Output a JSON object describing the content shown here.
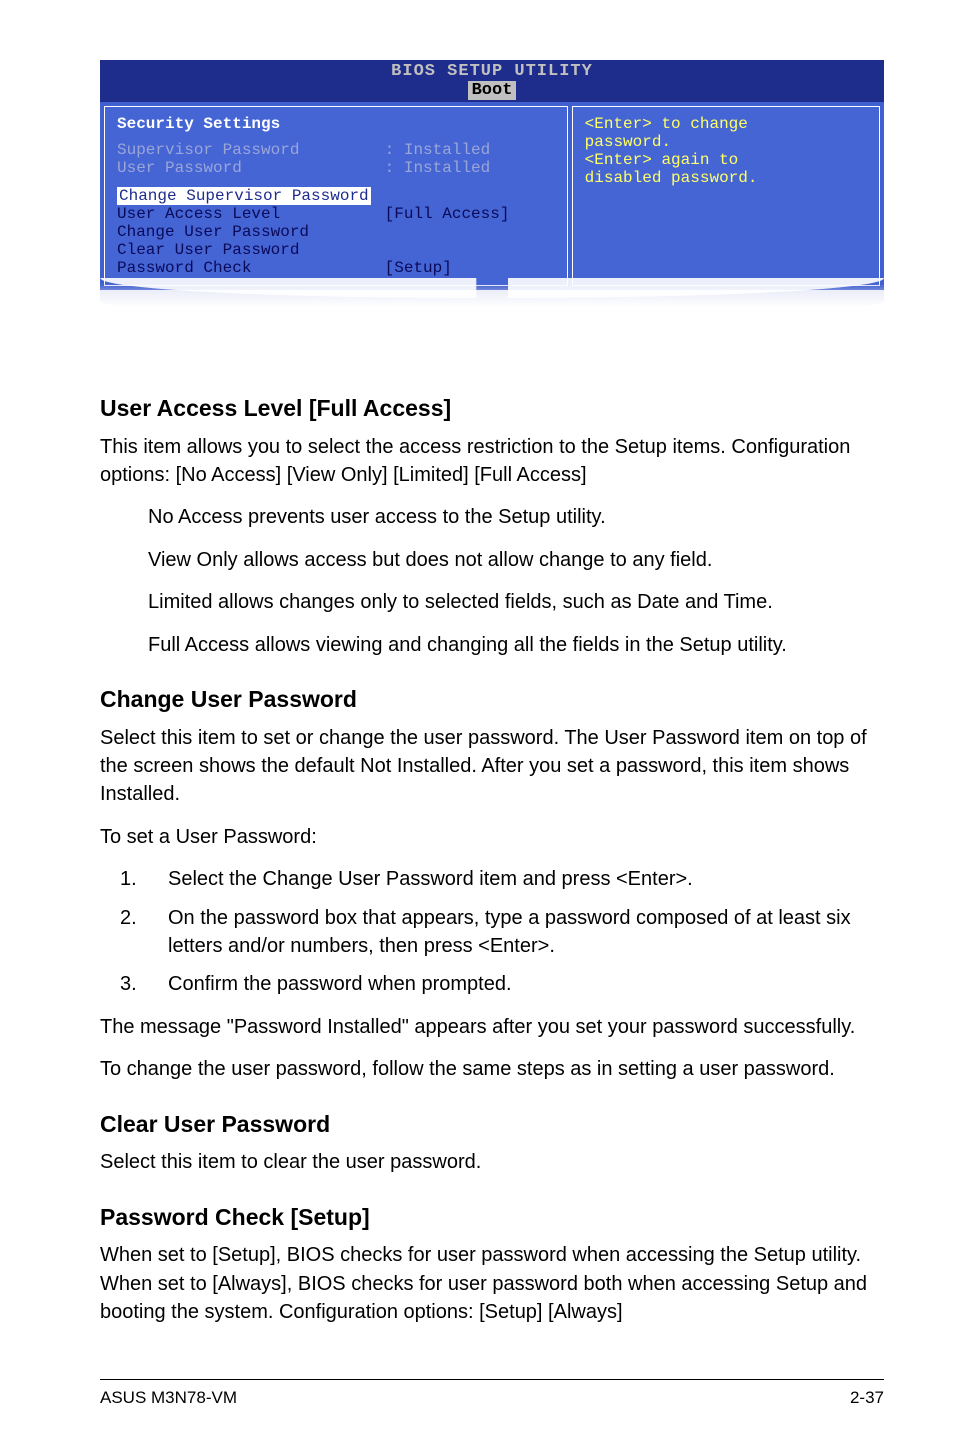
{
  "bios": {
    "title1": "BIOS SETUP UTILITY",
    "title2": "Boot",
    "left": {
      "heading": "Security Settings",
      "rows_grey": [
        {
          "label": "Supervisor Password",
          "value": ": Installed"
        },
        {
          "label": "User Password",
          "value": ": Installed"
        }
      ],
      "row_hl": "Change Supervisor Password",
      "rows_blue": [
        {
          "label": "User Access Level",
          "value": "[Full Access]"
        },
        {
          "label": "Change User Password",
          "value": ""
        },
        {
          "label": "Clear User Password",
          "value": ""
        },
        {
          "label": "Password Check",
          "value": "[Setup]"
        }
      ]
    },
    "right": {
      "l1": "<Enter> to change",
      "l2": "password.",
      "l3": "<Enter> again to",
      "l4": "disabled password."
    }
  },
  "doc": {
    "h_ual": "User Access Level [Full Access]",
    "ual_p": "This item allows you to select the access restriction to the Setup items. Configuration options: [No Access] [View Only] [Limited] [Full Access]",
    "ual_i1": "No Access prevents user access to the Setup utility.",
    "ual_i2": "View Only allows access but does not allow change to any field.",
    "ual_i3": "Limited allows changes only to selected fields, such as Date and Time.",
    "ual_i4": "Full Access allows viewing and changing all the fields in the Setup utility.",
    "h_cup": "Change User Password",
    "cup_p1": "Select this item to set or change the user password. The User Password item on top of the screen shows the default Not Installed. After you set a password, this item shows Installed.",
    "cup_p2": "To set a User Password:",
    "ol1": "Select the Change User Password item and press <Enter>.",
    "ol2": "On the password box that appears, type a password composed of at least six letters and/or numbers, then press <Enter>.",
    "ol3": "Confirm the password when prompted.",
    "cup_p3": "The message \"Password Installed\" appears after you set your password successfully.",
    "cup_p4": "To change the user password, follow the same steps as in setting a user password.",
    "h_clr": "Clear User Password",
    "clr_p": "Select this item to clear the user password.",
    "h_pwc": "Password Check [Setup]",
    "pwc_p": "When set to [Setup], BIOS checks for user password when accessing the Setup utility. When set to [Always], BIOS checks for user password both when accessing Setup and booting the system. Configuration options: [Setup] [Always]",
    "n1": "1.",
    "n2": "2.",
    "n3": "3."
  },
  "footer": {
    "left": "ASUS M3N78-VM",
    "right": "2-37"
  }
}
